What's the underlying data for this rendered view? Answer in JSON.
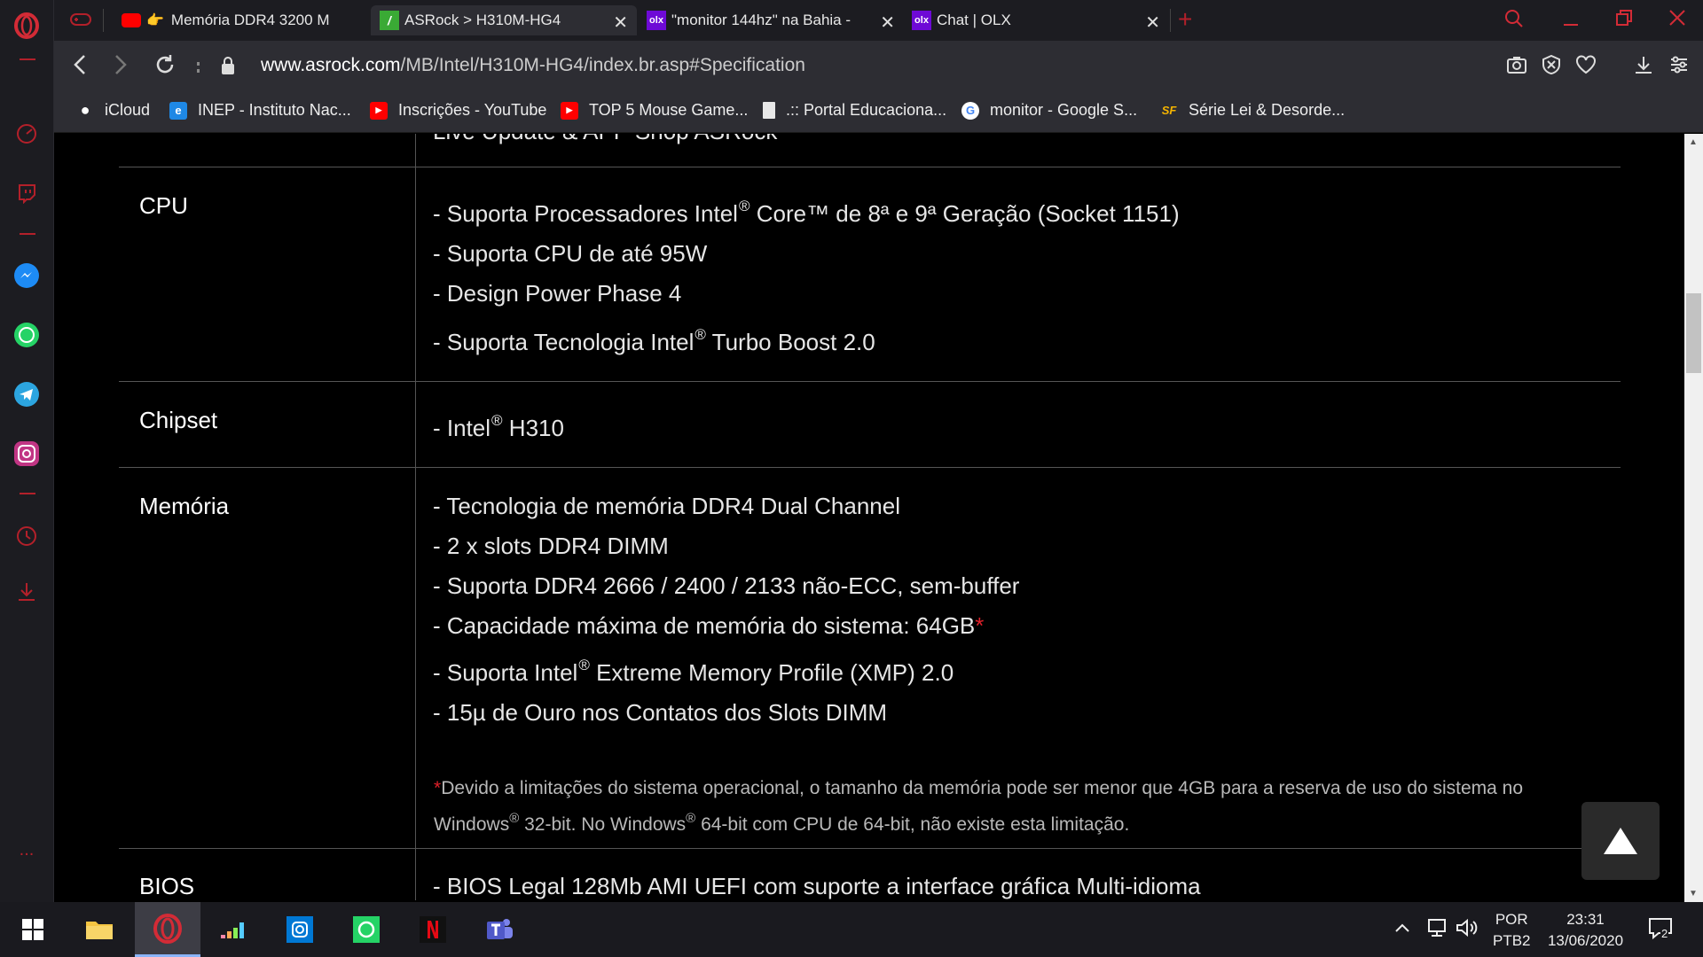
{
  "sidebar": {
    "items": [
      "opera-logo-icon",
      "speed-dial-icon",
      "twitch-icon",
      "messenger-icon",
      "whatsapp-icon",
      "telegram-icon",
      "instagram-icon",
      "history-icon",
      "downloads-icon",
      "more-icon"
    ],
    "more": "..."
  },
  "tabs": [
    {
      "title": "Memória DDR4 3200 M",
      "close": "✕"
    },
    {
      "title": "ASRock > H310M-HG4",
      "close": "✕"
    },
    {
      "title": "\"monitor 144hz\" na Bahia -",
      "close": "✕"
    },
    {
      "title": "Chat | OLX",
      "close": "✕"
    }
  ],
  "new_tab": "+",
  "address": {
    "domain": "www.asrock.com",
    "path": "/MB/Intel/H310M-HG4/index.br.asp#Specification"
  },
  "bookmarks": [
    {
      "label": "iCloud",
      "icon": "apple-icon"
    },
    {
      "label": "INEP - Instituto Nac...",
      "icon": "ie-icon"
    },
    {
      "label": "Inscrições - YouTube",
      "icon": "youtube-icon"
    },
    {
      "label": "TOP 5 Mouse Game...",
      "icon": "youtube-icon"
    },
    {
      "label": ".:: Portal Educaciona...",
      "icon": "page-icon"
    },
    {
      "label": "monitor - Google S...",
      "icon": "google-icon"
    },
    {
      "label": "Série Lei & Desorde...",
      "icon": "sf-icon"
    }
  ],
  "spec": {
    "cut_off_text": "Live Update & APP Shop ASRock",
    "cpu": {
      "label": "CPU",
      "lines": [
        {
          "pre": "- Suporta Processadores Intel",
          "sup": "®",
          "post": " Core™ de 8ª e 9ª Geração (Socket 1151)"
        },
        {
          "pre": "- Suporta CPU de até 95W",
          "sup": "",
          "post": ""
        },
        {
          "pre": "- Design Power Phase 4",
          "sup": "",
          "post": ""
        },
        {
          "pre": "- Suporta Tecnologia Intel",
          "sup": "®",
          "post": " Turbo Boost 2.0"
        }
      ]
    },
    "chipset": {
      "label": "Chipset",
      "lines": [
        {
          "pre": "- Intel",
          "sup": "®",
          "post": " H310"
        }
      ]
    },
    "memoria": {
      "label": "Memória",
      "lines": [
        {
          "pre": "- Tecnologia de memória DDR4 Dual Channel",
          "sup": "",
          "post": ""
        },
        {
          "pre": "- 2 x slots DDR4 DIMM",
          "sup": "",
          "post": ""
        },
        {
          "pre": "- Suporta DDR4 2666 / 2400 / 2133 não-ECC, sem-buffer",
          "sup": "",
          "post": ""
        },
        {
          "pre": "- Capacidade máxima de memória do sistema: 64GB",
          "sup": "",
          "post": "",
          "asterisk": "*"
        },
        {
          "pre": "- Suporta Intel",
          "sup": "®",
          "post": " Extreme Memory Profile (XMP) 2.0"
        },
        {
          "pre": "- 15µ de Ouro nos Contatos dos Slots DIMM",
          "sup": "",
          "post": ""
        }
      ],
      "note_asterisk": "*",
      "note_line1": "Devido a limitações do sistema operacional, o tamanho da memória pode ser menor que 4GB para a reserva de uso do sistema no",
      "note_line2_a": "Windows",
      "note_line2_b": " 32-bit. No Windows",
      "note_line2_c": " 64-bit com CPU de 64-bit, não existe esta limitação.",
      "note_sup": "®"
    },
    "bios": {
      "label": "BIOS",
      "lines": [
        {
          "pre": "- BIOS Legal 128Mb AMI UEFI com suporte a interface gráfica Multi-idioma",
          "sup": "",
          "post": ""
        }
      ]
    }
  },
  "taskbar": {
    "apps": [
      "windows-start-icon",
      "file-explorer-icon",
      "opera-icon",
      "deezer-icon",
      "instagram-icon",
      "whatsapp-icon",
      "netflix-icon",
      "teams-icon"
    ],
    "lang_top": "POR",
    "lang_bottom": "PTB2",
    "time": "23:31",
    "date": "13/06/2020",
    "notifications": "2"
  }
}
